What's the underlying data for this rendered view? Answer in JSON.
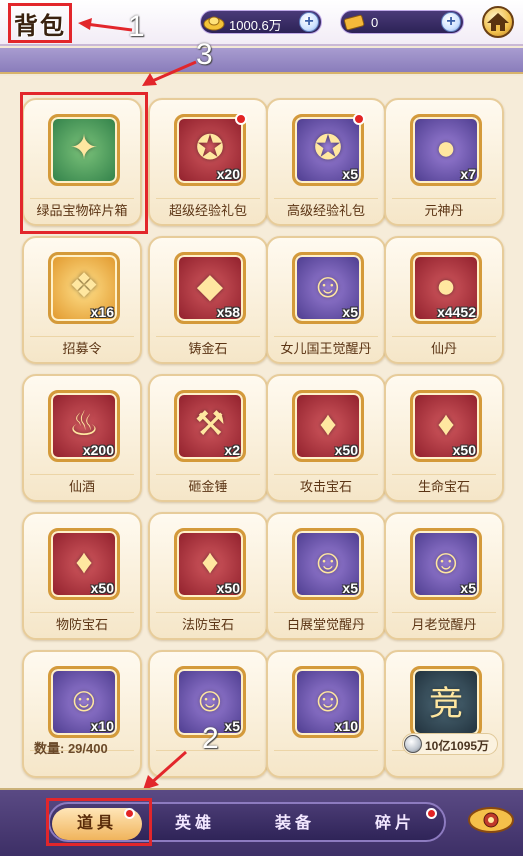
{
  "header": {
    "title": "背包",
    "gold_value": "1000.6万",
    "ticket_value": "0",
    "colors": {
      "accent_red": "#e2262b",
      "topbar_bg": "#f2ecf6"
    }
  },
  "annotations": {
    "label_1": "1",
    "label_2": "2",
    "label_3": "3"
  },
  "items": [
    {
      "name": "绿品宝物碎片箱",
      "qty": "",
      "icon": "treasure-chest-icon",
      "bg": "green",
      "dot": false,
      "glyph": "✦"
    },
    {
      "name": "超级经验礼包",
      "qty": "x20",
      "icon": "gift-box-icon",
      "bg": "red",
      "dot": true,
      "glyph": "✪"
    },
    {
      "name": "高级经验礼包",
      "qty": "x5",
      "icon": "gift-box-icon",
      "bg": "purple",
      "dot": true,
      "glyph": "✪"
    },
    {
      "name": "元神丹",
      "qty": "x7",
      "icon": "orb-icon",
      "bg": "purple",
      "dot": false,
      "glyph": "●"
    },
    {
      "name": "招募令",
      "qty": "x16",
      "icon": "scroll-icon",
      "bg": "gold",
      "dot": false,
      "glyph": "❖"
    },
    {
      "name": "铸金石",
      "qty": "x58",
      "icon": "crystal-icon",
      "bg": "red",
      "dot": false,
      "glyph": "◆"
    },
    {
      "name": "女儿国王觉醒丹",
      "qty": "x5",
      "icon": "character-portrait-icon",
      "bg": "purple",
      "dot": false,
      "glyph": "☺"
    },
    {
      "name": "仙丹",
      "qty": "x4452",
      "icon": "elixir-pill-icon",
      "bg": "red",
      "dot": false,
      "glyph": "●"
    },
    {
      "name": "仙酒",
      "qty": "x200",
      "icon": "teapot-icon",
      "bg": "red",
      "dot": false,
      "glyph": "♨"
    },
    {
      "name": "砸金锤",
      "qty": "x2",
      "icon": "hammer-icon",
      "bg": "red",
      "dot": false,
      "glyph": "⚒"
    },
    {
      "name": "攻击宝石",
      "qty": "x50",
      "icon": "red-gem-icon",
      "bg": "red",
      "dot": false,
      "glyph": "♦"
    },
    {
      "name": "生命宝石",
      "qty": "x50",
      "icon": "green-gem-icon",
      "bg": "red",
      "dot": false,
      "glyph": "♦"
    },
    {
      "name": "物防宝石",
      "qty": "x50",
      "icon": "yellow-gem-icon",
      "bg": "red",
      "dot": false,
      "glyph": "♦"
    },
    {
      "name": "法防宝石",
      "qty": "x50",
      "icon": "blue-gem-icon",
      "bg": "red",
      "dot": false,
      "glyph": "♦"
    },
    {
      "name": "白展堂觉醒丹",
      "qty": "x5",
      "icon": "character-portrait-icon",
      "bg": "purple",
      "dot": false,
      "glyph": "☺"
    },
    {
      "name": "月老觉醒丹",
      "qty": "x5",
      "icon": "character-portrait-icon",
      "bg": "purple",
      "dot": false,
      "glyph": "☺"
    },
    {
      "name": "",
      "qty": "x10",
      "icon": "character-portrait-icon",
      "bg": "purple",
      "dot": false,
      "glyph": "☺"
    },
    {
      "name": "",
      "qty": "x5",
      "icon": "character-portrait-icon",
      "bg": "purple",
      "dot": false,
      "glyph": "☺"
    },
    {
      "name": "",
      "qty": "x10",
      "icon": "character-portrait-icon",
      "bg": "purple",
      "dot": false,
      "glyph": "☺"
    },
    {
      "name": "",
      "qty": "",
      "icon": "arena-token-icon",
      "bg": "teal",
      "dot": false,
      "glyph": "竞"
    }
  ],
  "footer": {
    "count_label": "数量: 29/400",
    "coin_value": "10亿1095万"
  },
  "tabs": [
    {
      "label": "道具",
      "active": true,
      "dot": true
    },
    {
      "label": "英雄",
      "active": false,
      "dot": false
    },
    {
      "label": "装备",
      "active": false,
      "dot": false
    },
    {
      "label": "碎片",
      "active": false,
      "dot": true
    }
  ]
}
